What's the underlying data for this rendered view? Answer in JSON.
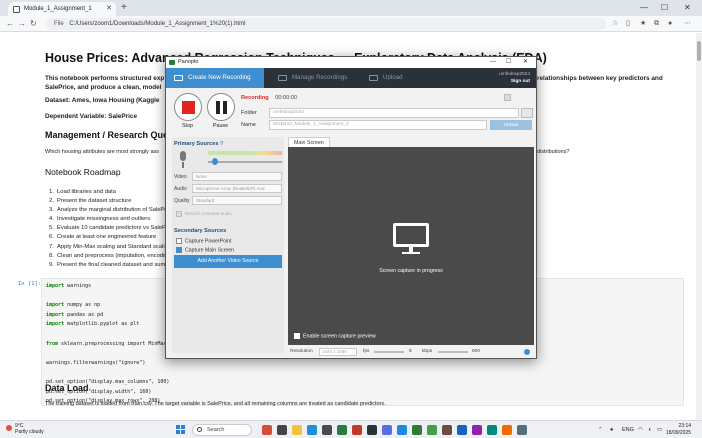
{
  "browser": {
    "tab_title": "Module_1_Assignment_1",
    "address_prefix": "File",
    "url": "C:/Users/zoom1/Downloads/Module_1_Assignment_1%20(1).html"
  },
  "notebook": {
    "title": "House Prices: Advanced Regression Techniques — Exploratory Data Analysis (EDA)",
    "intro_left": "This notebook performs structured exp",
    "intro_right": "relationships between key predictors and",
    "intro_line2": "SalePrice, and produce a clean, model",
    "dataset": "Dataset: Ames, Iowa Housing (Kaggle",
    "dependent": "Dependent Variable: SalePrice",
    "mgmt_heading": "Management / Research Questio",
    "question": "Which housing attributes are most strongly ass",
    "question_right": "distributions?",
    "roadmap_heading": "Notebook Roadmap",
    "roadmap": [
      "Load libraries and data",
      "Present the dataset structure",
      "Analyze the marginal distribution of SalePri",
      "Investigate missingness and outliers",
      "Evaluate 10 candidate predictors vs SalePri",
      "Create at least one engineered feature",
      "Apply Min-Max scaling and Standard scaling",
      "Clean and preprocess (imputation, encodin",
      "Present the final cleaned dataset and summ"
    ],
    "prompt": "In [1]:",
    "code_lines": [
      [
        "import",
        " warnings"
      ],
      [
        "",
        ""
      ],
      [
        "import",
        " numpy as np"
      ],
      [
        "import",
        " pandas as pd"
      ],
      [
        "import",
        " matplotlib.pyplot as plt"
      ],
      [
        "",
        ""
      ],
      [
        "from",
        " sklearn.preprocessing import MinMaxS"
      ],
      [
        "",
        ""
      ],
      [
        "",
        "warnings.filterwarnings(\"ignore\")"
      ],
      [
        "",
        ""
      ],
      [
        "",
        "pd.set_option(\"display.max_columns\", 100)"
      ],
      [
        "",
        "pd.set_option(\"display.width\", 160)"
      ],
      [
        "",
        "pd.set_option(\"display.max_rows\", 200)"
      ]
    ],
    "data_load_heading": "Data Load",
    "data_load_text": "The training dataset is loaded from train.csv. The target variable is SalePrice, and all remaining columns are treated as candidate predictors."
  },
  "panopto": {
    "app_title": "Panopto",
    "tab_create": "Create New Recording",
    "tab_manage": "Manage Recordings",
    "tab_upload": "Upload",
    "user_name": "umfedrap2024",
    "signout": "Sign out",
    "stop_label": "Stop",
    "pause_label": "Pause",
    "recording_label": "Recording",
    "recording_time": "00:00:00",
    "folder_label": "Folder",
    "folder_value": "umfedrap2024",
    "name_label": "Name",
    "name_value": "MGB422_Module_1_Assignment_1",
    "upload_btn": "Upload",
    "primary_sources": "Primary Sources",
    "video_label": "Video",
    "video_value": "None",
    "audio_label": "Audio",
    "audio_value": "Microphone Array (Realtek(R) Aud",
    "quality_label": "Quality",
    "quality_value": "Standard",
    "record_computer_audio": "Record computer audio",
    "secondary_sources": "Secondary Sources",
    "capture_powerpoint": "Capture PowerPoint",
    "capture_main_screen": "Capture Main Screen",
    "add_video_btn": "Add Another Video Source",
    "screen_tab": "Main Screen",
    "preview_msg": "Screen capture in progress",
    "enable_preview": "Enable screen capture preview",
    "resolution_label": "Resolution",
    "resolution_value": "1920 x 1080",
    "fps_label": "fps",
    "fps_value": "8",
    "kbps_label": "kbps",
    "kbps_value": "600",
    "audio_level": 0.1,
    "record_colour": "#e0261e",
    "accent_colour": "#3e8ed0"
  },
  "taskbar": {
    "temperature": "9°C",
    "condition": "Partly cloudy",
    "search": "Search",
    "lang": "ENG",
    "time": "23:14",
    "date": "18/09/2025"
  }
}
